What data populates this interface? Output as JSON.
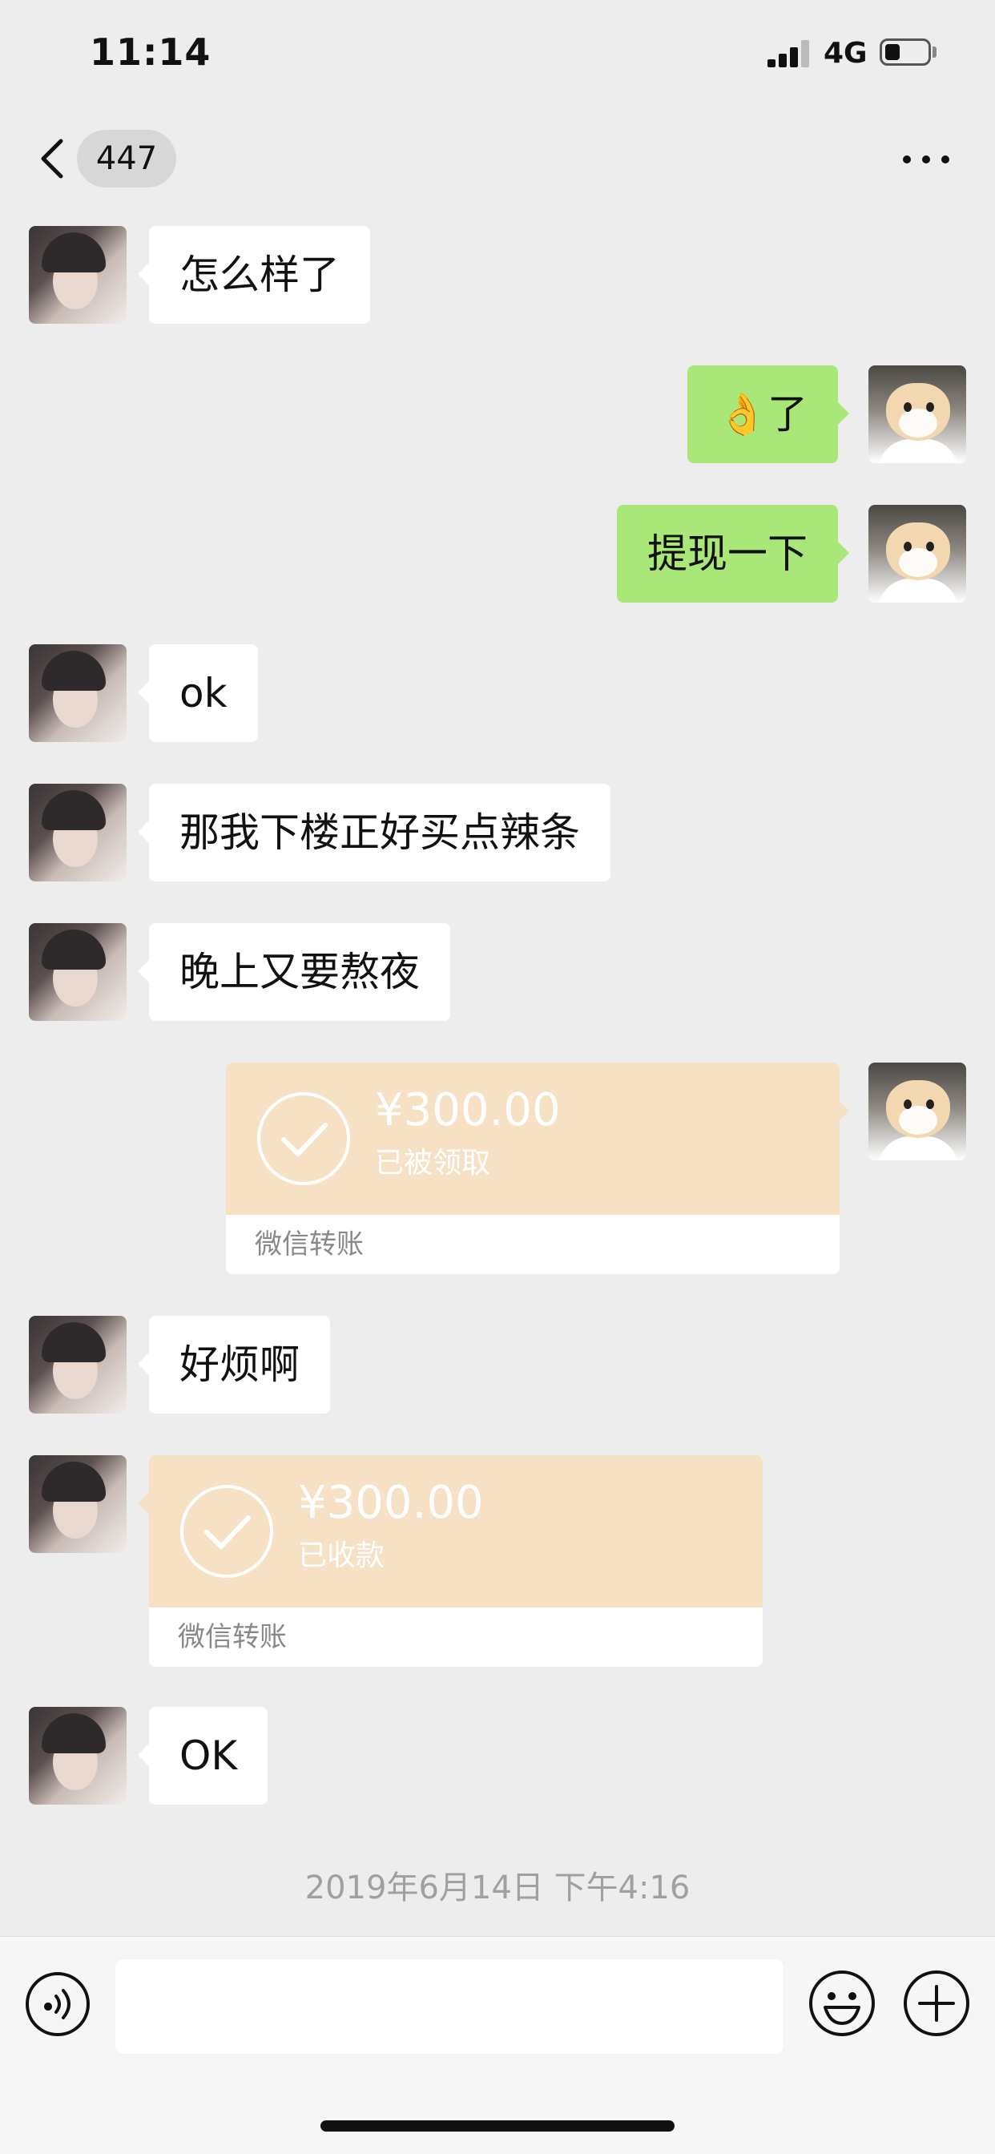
{
  "status_bar": {
    "time": "11:14",
    "network": "4G",
    "battery_level": 0.35
  },
  "nav": {
    "unread_count": "447",
    "back_icon": "chevron-left-icon",
    "more_icon": "more-dots-icon"
  },
  "messages": [
    {
      "side": "left",
      "type": "text",
      "text": "怎么样了"
    },
    {
      "side": "right",
      "type": "text",
      "emoji": "👌",
      "text": "了"
    },
    {
      "side": "right",
      "type": "text",
      "text": "提现一下"
    },
    {
      "side": "left",
      "type": "text",
      "text": "ok"
    },
    {
      "side": "left",
      "type": "text",
      "text": "那我下楼正好买点辣条"
    },
    {
      "side": "left",
      "type": "text",
      "text": "晚上又要熬夜"
    },
    {
      "side": "right",
      "type": "transfer",
      "amount": "¥300.00",
      "status": "已被领取",
      "label": "微信转账"
    },
    {
      "side": "left",
      "type": "text",
      "text": "好烦啊"
    },
    {
      "side": "left",
      "type": "transfer",
      "amount": "¥300.00",
      "status": "已收款",
      "label": "微信转账"
    },
    {
      "side": "left",
      "type": "text",
      "text": "OK"
    }
  ],
  "timestamp": "2019年6月14日 下午4:16",
  "input_bar": {
    "voice_icon": "voice-icon",
    "emoji_icon": "emoji-icon",
    "plus_icon": "plus-icon",
    "input_value": ""
  },
  "colors": {
    "background": "#ededed",
    "bubble_sent": "#a9e878",
    "bubble_received": "#ffffff",
    "transfer": "#f7e1c4"
  }
}
